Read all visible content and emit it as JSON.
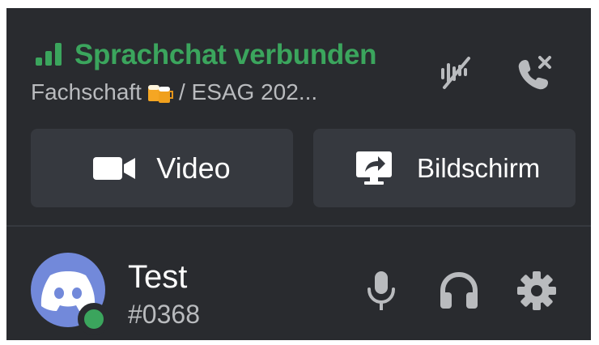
{
  "voice": {
    "status": "Sprachchat verbunden",
    "channel_prefix": "Fachschaft",
    "channel_emoji": "beer-mugs-icon",
    "channel_suffix": " / ESAG 202...",
    "actions": [
      {
        "name": "noise-suppression-icon"
      },
      {
        "name": "disconnect-call-icon"
      }
    ],
    "buttons": {
      "video_label": "Video",
      "screen_label": "Bildschirm"
    }
  },
  "user": {
    "name": "Test",
    "tag": "#0368",
    "status": "online",
    "actions": [
      {
        "name": "microphone-icon"
      },
      {
        "name": "headphones-icon"
      },
      {
        "name": "gear-icon"
      }
    ]
  },
  "colors": {
    "panel_bg": "#292b2f",
    "button_bg": "#36393f",
    "connected_green": "#3ba55d",
    "muted_text": "#b9bbbe",
    "icon_gray": "#b9bbbe",
    "avatar_blurple": "#7289da",
    "hangup_icon": "#b9bbbe"
  }
}
